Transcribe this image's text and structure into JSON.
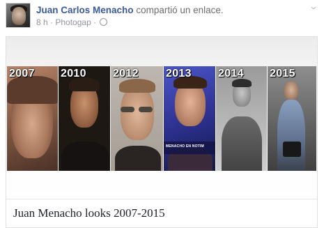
{
  "post": {
    "author": "Juan Carlos Menacho",
    "action": "compartió un enlace.",
    "time": "8 h",
    "via": "Photogap",
    "separator": "·",
    "chevron": "⌄",
    "icons": {
      "privacy": "globe-icon",
      "menu": "chevron-down-icon"
    }
  },
  "link": {
    "title": "Juan Menacho looks 2007-2015",
    "photos": [
      {
        "year": "2007"
      },
      {
        "year": "2010"
      },
      {
        "year": "2012"
      },
      {
        "year": "2013",
        "caption": "MENACHO EN NOTIM"
      },
      {
        "year": "2014"
      },
      {
        "year": "2015"
      }
    ]
  }
}
